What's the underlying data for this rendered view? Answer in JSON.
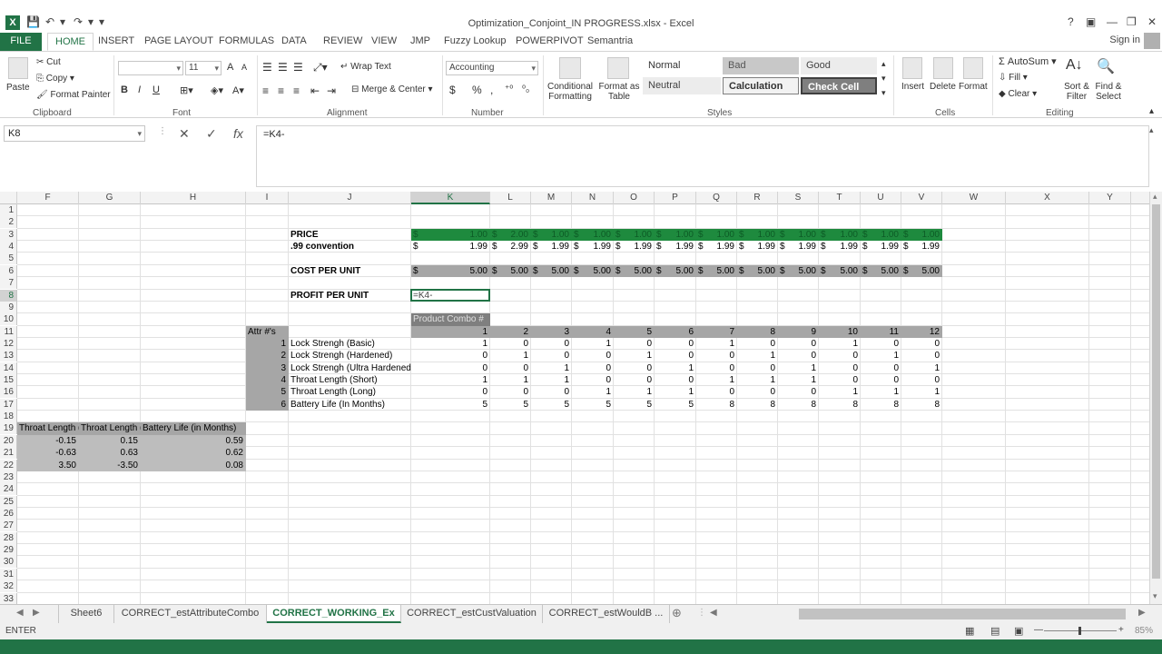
{
  "window": {
    "title": "Optimization_Conjoint_IN PROGRESS.xlsx - Excel",
    "help": "?",
    "ribbon_opts": "▣",
    "minimize": "—",
    "restore": "❐",
    "close": "✕",
    "logo": "X"
  },
  "qat": {
    "save": "💾",
    "undo": "↶",
    "redo": "↷",
    "more": "▾"
  },
  "tabs": [
    "FILE",
    "HOME",
    "INSERT",
    "PAGE LAYOUT",
    "FORMULAS",
    "DATA",
    "REVIEW",
    "VIEW",
    "JMP",
    "Fuzzy Lookup",
    "POWERPIVOT",
    "Semantria"
  ],
  "signin": "Sign in",
  "ribbon": {
    "clipboard": {
      "paste": "Paste",
      "cut": "Cut",
      "copy": "Copy",
      "format_painter": "Format Painter",
      "label": "Clipboard"
    },
    "font": {
      "size": "11",
      "bold": "B",
      "italic": "I",
      "underline": "U",
      "grow": "A",
      "shrink": "A",
      "label": "Font"
    },
    "alignment": {
      "wrap": "Wrap Text",
      "merge": "Merge & Center",
      "label": "Alignment"
    },
    "number": {
      "format": "Accounting",
      "currency": "$",
      "percent": "%",
      "comma": ",",
      "label": "Number"
    },
    "styles": {
      "conditional": "Conditional Formatting",
      "format_table": "Format as Table",
      "cells": [
        "Normal",
        "Bad",
        "Good",
        "Neutral",
        "Calculation",
        "Check Cell"
      ],
      "label": "Styles"
    },
    "cells": {
      "insert": "Insert",
      "delete": "Delete",
      "format": "Format",
      "label": "Cells"
    },
    "editing": {
      "autosum": "AutoSum",
      "fill": "Fill",
      "clear": "Clear",
      "sort": "Sort & Filter",
      "find": "Find & Select",
      "label": "Editing"
    }
  },
  "formula_bar": {
    "name_box": "K8",
    "cancel": "✕",
    "enter": "✓",
    "fx": "fx",
    "formula": "=K4-"
  },
  "columns": [
    "F",
    "G",
    "H",
    "I",
    "J",
    "K",
    "L",
    "M",
    "N",
    "O",
    "P",
    "Q",
    "R",
    "S",
    "T",
    "U",
    "V",
    "W",
    "X",
    "Y"
  ],
  "rows": [
    "1",
    "2",
    "3",
    "4",
    "5",
    "6",
    "7",
    "8",
    "9",
    "10",
    "11",
    "12",
    "13",
    "14",
    "15",
    "16",
    "17",
    "18",
    "19",
    "20",
    "21",
    "22",
    "23",
    "24",
    "25",
    "26",
    "27",
    "28",
    "29",
    "30",
    "31",
    "32",
    "33"
  ],
  "sheet": {
    "price_label": "PRICE",
    "convention_label": ".99 convention",
    "cost_label": "COST PER UNIT",
    "profit_label": "PROFIT PER UNIT",
    "editing_cell": "=K4-",
    "product_combo_label": "Product Combo #",
    "attr_label": "Attr #'s",
    "dollar": "$",
    "price_row": [
      "1.00",
      "2.00",
      "1.00",
      "1.00",
      "1.00",
      "1.00",
      "1.00",
      "1.00",
      "1.00",
      "1.00",
      "1.00",
      "1.00"
    ],
    "convention_row": [
      "1.99",
      "2.99",
      "1.99",
      "1.99",
      "1.99",
      "1.99",
      "1.99",
      "1.99",
      "1.99",
      "1.99",
      "1.99",
      "1.99"
    ],
    "cost_row": [
      "5.00",
      "5.00",
      "5.00",
      "5.00",
      "5.00",
      "5.00",
      "5.00",
      "5.00",
      "5.00",
      "5.00",
      "5.00",
      "5.00"
    ],
    "combo_numbers": [
      "1",
      "2",
      "3",
      "4",
      "5",
      "6",
      "7",
      "8",
      "9",
      "10",
      "11",
      "12"
    ],
    "attributes": [
      {
        "num": "1",
        "name": "Lock Strengh (Basic)",
        "values": [
          "1",
          "0",
          "0",
          "1",
          "0",
          "0",
          "1",
          "0",
          "0",
          "1",
          "0",
          "0"
        ]
      },
      {
        "num": "2",
        "name": "Lock Strengh (Hardened)",
        "values": [
          "0",
          "1",
          "0",
          "0",
          "1",
          "0",
          "0",
          "1",
          "0",
          "0",
          "1",
          "0"
        ]
      },
      {
        "num": "3",
        "name": "Lock Strengh (Ultra Hardened)",
        "values": [
          "0",
          "0",
          "1",
          "0",
          "0",
          "1",
          "0",
          "0",
          "1",
          "0",
          "0",
          "1"
        ]
      },
      {
        "num": "4",
        "name": "Throat Length (Short)",
        "values": [
          "1",
          "1",
          "1",
          "0",
          "0",
          "0",
          "1",
          "1",
          "1",
          "0",
          "0",
          "0"
        ]
      },
      {
        "num": "5",
        "name": "Throat Length (Long)",
        "values": [
          "0",
          "0",
          "0",
          "1",
          "1",
          "1",
          "0",
          "0",
          "0",
          "1",
          "1",
          "1"
        ]
      },
      {
        "num": "6",
        "name": "Battery Life (In Months)",
        "values": [
          "5",
          "5",
          "5",
          "5",
          "5",
          "5",
          "8",
          "8",
          "8",
          "8",
          "8",
          "8"
        ]
      }
    ],
    "left_table": {
      "headers": [
        "Throat Length (",
        "Throat Length (",
        "Battery Life (in Months)"
      ],
      "rows": [
        [
          "-0.15",
          "0.15",
          "0.59"
        ],
        [
          "-0.63",
          "0.63",
          "0.62"
        ],
        [
          "3.50",
          "-3.50",
          "0.08"
        ]
      ]
    }
  },
  "sheet_tabs": [
    "Sheet6",
    "CORRECT_estAttributeCombo",
    "CORRECT_WORKING_Ex",
    "CORRECT_estCustValuation",
    "CORRECT_estWouldB ..."
  ],
  "add_sheet": "⊕",
  "status": {
    "mode": "ENTER",
    "zoom": "85%"
  },
  "colors": {
    "excel_green": "#217346",
    "price_fill": "#1e8a3e",
    "gray_fill": "#a6a6a6",
    "dark_fill": "#7f7f7f"
  }
}
